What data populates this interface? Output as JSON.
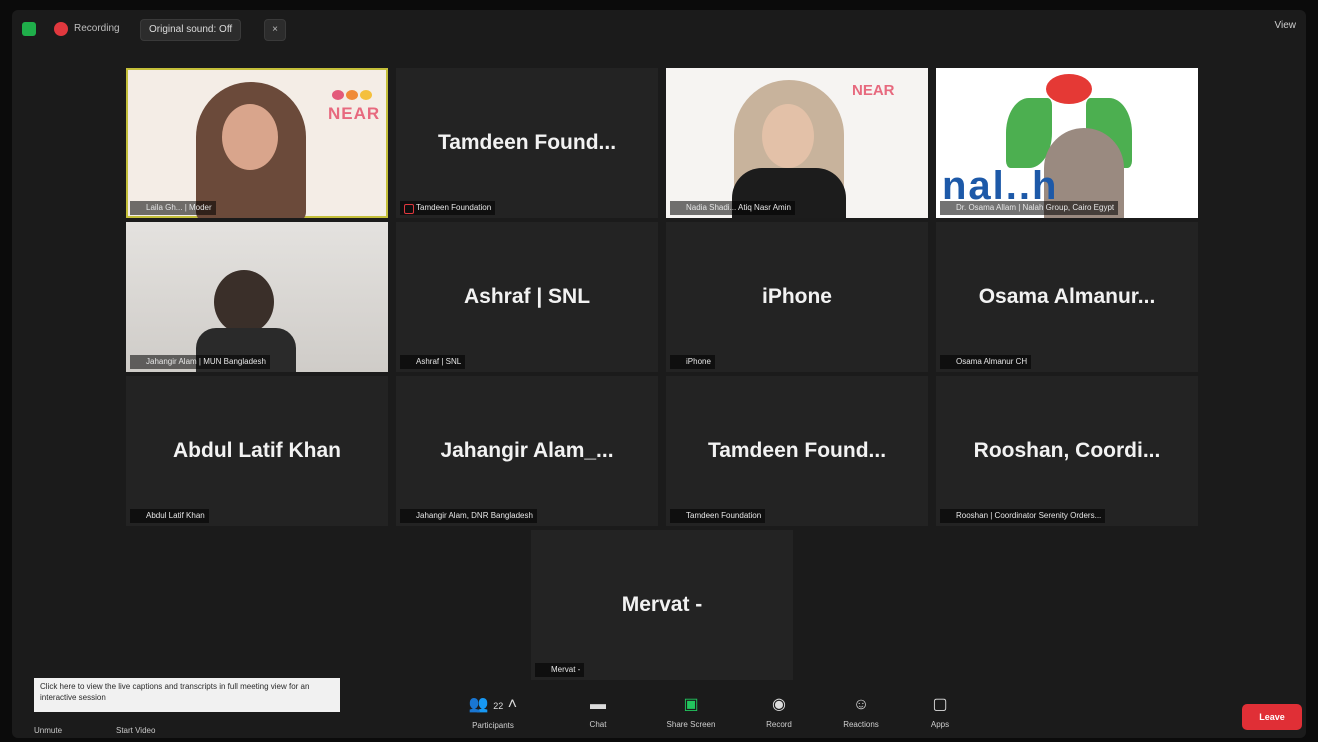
{
  "topbar": {
    "recording_label": "Recording",
    "view_label": "Original sound: Off",
    "close_symbol": "×",
    "view_button": "View"
  },
  "tiles": [
    {
      "display_name": "",
      "label": "Laila Gh... | Moder"
    },
    {
      "display_name": "Tamdeen Found...",
      "label": "Tamdeen Foundation"
    },
    {
      "display_name": "",
      "label": "Nadia Shadi... Atiq Nasr Amin"
    },
    {
      "display_name": "",
      "label": "Dr. Osama Allam | Nalah Group, Cairo Egypt"
    },
    {
      "display_name": "",
      "label": "Jahangir Alam | MUN Bangladesh"
    },
    {
      "display_name": "Ashraf | SNL",
      "label": "Ashraf | SNL"
    },
    {
      "display_name": "iPhone",
      "label": "iPhone"
    },
    {
      "display_name": "Osama Almanur...",
      "label": "Osama Almanur CH"
    },
    {
      "display_name": "Abdul Latif Khan",
      "label": "Abdul Latif Khan"
    },
    {
      "display_name": "Jahangir Alam_...",
      "label": "Jahangir Alam, DNR Bangladesh"
    },
    {
      "display_name": "Tamdeen Found...",
      "label": "Tamdeen Foundation"
    },
    {
      "display_name": "Rooshan, Coordi...",
      "label": "Rooshan | Coordinator Serenity Orders..."
    },
    {
      "display_name": "Mervat -",
      "label": "Mervat -"
    }
  ],
  "photo_overlays": {
    "near_logo": "NEAR",
    "nalah_logo": "nal..h"
  },
  "caption": {
    "text": "Click here to view the live captions and transcripts in full meeting view for an interactive session"
  },
  "controls": {
    "unmute_label": "Unmute",
    "start_video_label": "Start Video",
    "participants_label": "Participants",
    "participants_count": "22",
    "chat_label": "Chat",
    "share_screen_label": "Share Screen",
    "record_label": "Record",
    "reactions_label": "Reactions",
    "apps_label": "Apps",
    "leave_label": "Leave"
  },
  "colors": {
    "background": "#1b1b1b",
    "tile": "#232323",
    "active_border": "#c4bf3a",
    "leave": "#e02f36",
    "share": "#22c55e",
    "recording": "#e0383e"
  }
}
